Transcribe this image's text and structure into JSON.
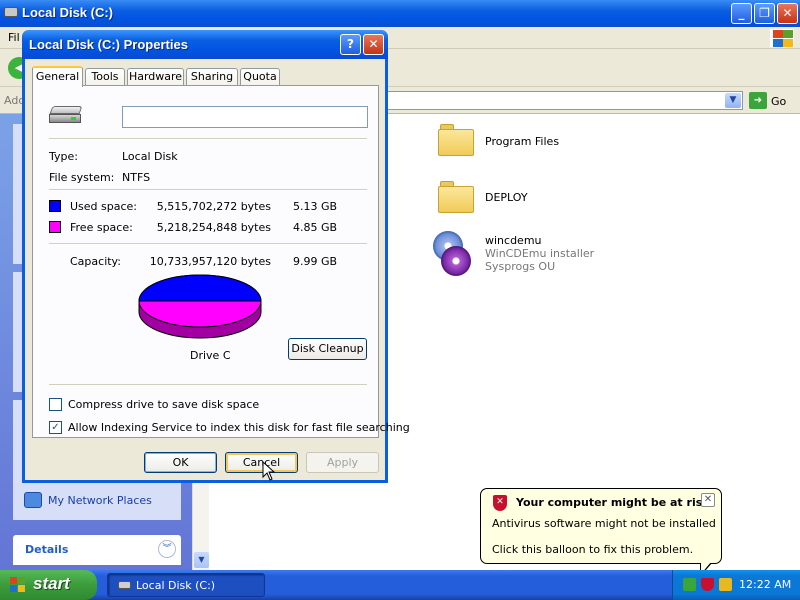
{
  "explorer": {
    "title": "Local Disk (C:)",
    "menu_partial": "Fil",
    "address_label": "Add",
    "go_label": "Go",
    "items": [
      {
        "name": "Program Files"
      },
      {
        "name": "DEPLOY"
      },
      {
        "name": "wincdemu",
        "line2": "WinCDEmu installer",
        "line3": "Sysprogs OU"
      }
    ],
    "taskpane": {
      "link": "My Network Places",
      "details_title": "Details"
    }
  },
  "dialog": {
    "title": "Local Disk (C:) Properties",
    "tabs": [
      "General",
      "Tools",
      "Hardware",
      "Sharing",
      "Quota"
    ],
    "active_tab": "General",
    "volume_label_value": "",
    "type_label": "Type:",
    "type_value": "Local Disk",
    "fs_label": "File system:",
    "fs_value": "NTFS",
    "used_label": "Used space:",
    "used_bytes": "5,515,702,272 bytes",
    "used_gb": "5.13 GB",
    "free_label": "Free space:",
    "free_bytes": "5,218,254,848 bytes",
    "free_gb": "4.85 GB",
    "capacity_label": "Capacity:",
    "capacity_bytes": "10,733,957,120 bytes",
    "capacity_gb": "9.99 GB",
    "drive_caption": "Drive C",
    "disk_cleanup": "Disk Cleanup",
    "compress_label": "Compress drive to save disk space",
    "compress_checked": false,
    "index_label": "Allow Indexing Service to index this disk for fast file searching",
    "index_checked": true,
    "ok": "OK",
    "cancel": "Cancel",
    "apply": "Apply",
    "used_color": "#0000ff",
    "free_color": "#ff00ff"
  },
  "balloon": {
    "title": "Your computer might be at risk",
    "line1": "Antivirus software might not be installed",
    "line2": "Click this balloon to fix this problem."
  },
  "taskbar": {
    "start": "start",
    "task_button": "Local Disk (C:)",
    "clock": "12:22 AM"
  }
}
